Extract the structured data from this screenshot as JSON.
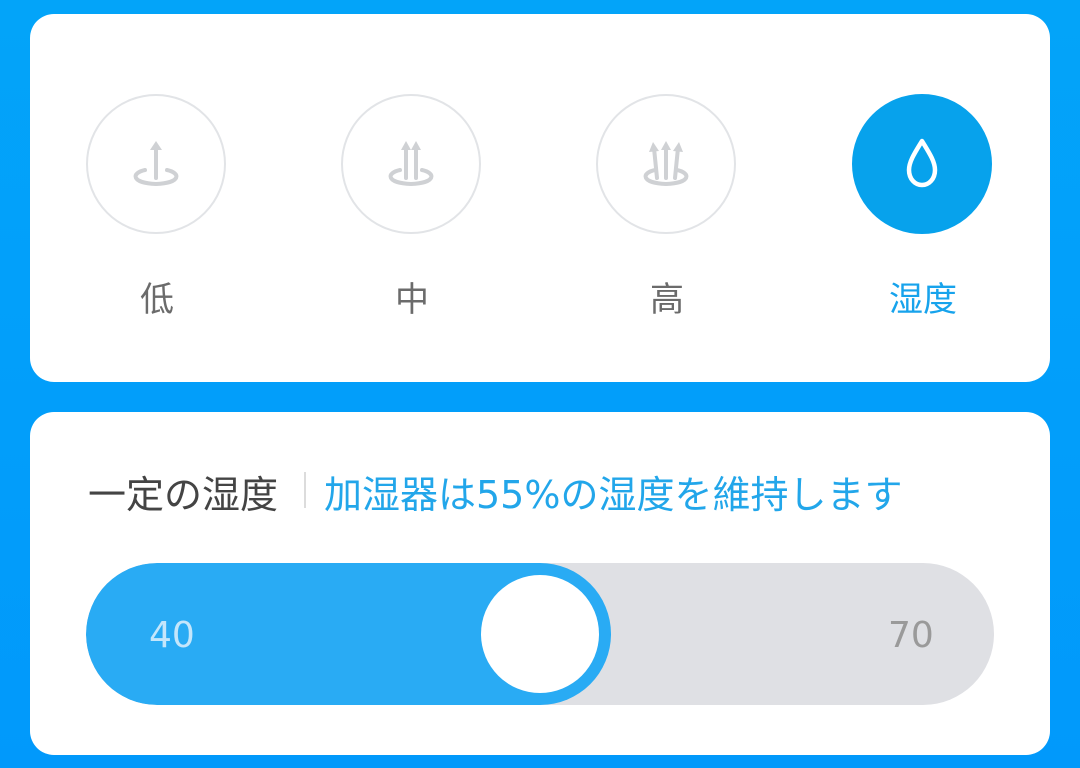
{
  "modes": {
    "low": {
      "label": "低",
      "icon": "single-arrow-up-icon"
    },
    "medium": {
      "label": "中",
      "icon": "double-arrow-up-icon"
    },
    "high": {
      "label": "高",
      "icon": "triple-arrow-up-icon"
    },
    "humidity": {
      "label": "湿度",
      "icon": "water-drop-icon"
    },
    "selected": "humidity"
  },
  "humidity": {
    "title": "一定の湿度",
    "description": "加湿器は55%の湿度を維持します",
    "slider": {
      "min_label": "40",
      "max_label": "70",
      "min": 40,
      "max": 70,
      "value": 55
    }
  },
  "colors": {
    "background": "#03a4f9",
    "accent": "#07a2ec",
    "inactive_icon": "#cfd1d4",
    "track": "#dfe0e4"
  }
}
